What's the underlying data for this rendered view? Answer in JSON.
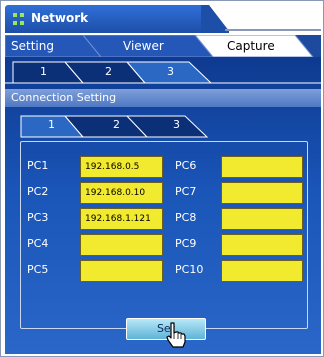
{
  "window": {
    "title": "Network"
  },
  "main_tabs": [
    {
      "label": "Setting",
      "active": false
    },
    {
      "label": "Viewer",
      "active": false
    },
    {
      "label": "Capture",
      "active": true
    }
  ],
  "sub_tabs": [
    {
      "label": "1",
      "active": false
    },
    {
      "label": "2",
      "active": false
    },
    {
      "label": "3",
      "active": true
    }
  ],
  "section": {
    "title": "Connection Setting"
  },
  "connection_tabs": [
    {
      "label": "1",
      "active": true
    },
    {
      "label": "2",
      "active": false
    },
    {
      "label": "3",
      "active": false
    }
  ],
  "pcs": [
    {
      "label": "PC1",
      "value": "192.168.0.5"
    },
    {
      "label": "PC2",
      "value": "192.168.0.10"
    },
    {
      "label": "PC3",
      "value": "192.168.1.121"
    },
    {
      "label": "PC4",
      "value": ""
    },
    {
      "label": "PC5",
      "value": ""
    },
    {
      "label": "PC6",
      "value": ""
    },
    {
      "label": "PC7",
      "value": ""
    },
    {
      "label": "PC8",
      "value": ""
    },
    {
      "label": "PC9",
      "value": ""
    },
    {
      "label": "PC10",
      "value": ""
    }
  ],
  "actions": {
    "set_label": "Set"
  },
  "colors": {
    "title_bar": "#1e4fa8",
    "field_fill": "#f2ea2e",
    "panel": "#1a55b8",
    "button": "#7cc6e4"
  },
  "icons": {
    "title": "grid-dots-icon",
    "cursor": "hand-pointer-icon"
  }
}
